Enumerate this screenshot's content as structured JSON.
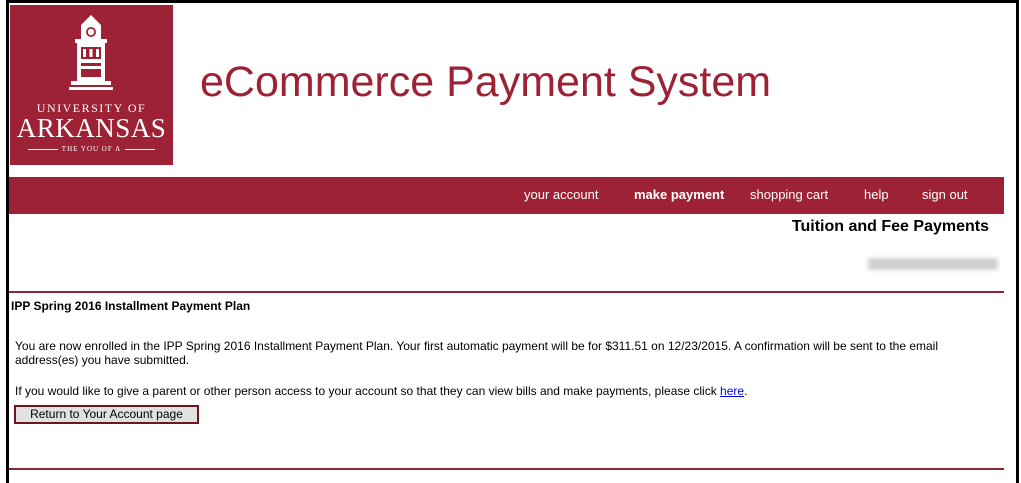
{
  "logo": {
    "line1": "UNIVERSITY OF",
    "line2": "ARKANSAS",
    "tagline": "THE YOU OF A"
  },
  "header": {
    "title": "eCommerce Payment System"
  },
  "nav": {
    "items": [
      {
        "label": "your account",
        "active": false
      },
      {
        "label": "make payment",
        "active": true
      },
      {
        "label": "shopping cart",
        "active": false
      },
      {
        "label": "help",
        "active": false
      },
      {
        "label": "sign out",
        "active": false
      }
    ]
  },
  "section": {
    "title": "Tuition and Fee Payments"
  },
  "plan": {
    "heading": "IPP Spring 2016 Installment Payment Plan",
    "message": "You are now enrolled in the IPP Spring 2016 Installment Payment Plan. Your first automatic payment will be for $311.51 on 12/23/2015. A confirmation will be sent to the email address(es) you have submitted.",
    "access_text": "If you would like to give a parent or other person access to your account so that they can view bills and make payments, please click ",
    "access_link": "here",
    "access_end": "."
  },
  "actions": {
    "return_label": "Return to Your Account page"
  },
  "colors": {
    "brand": "#9d2235",
    "rule": "#8c2631",
    "link": "#0000ee"
  }
}
